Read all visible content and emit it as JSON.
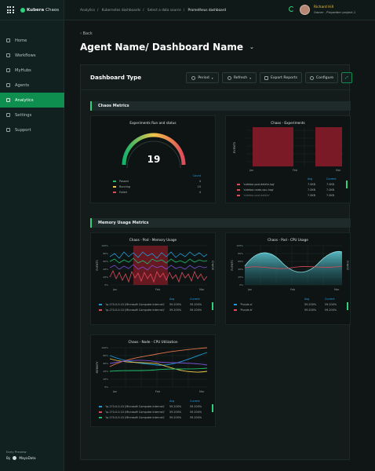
{
  "brand": {
    "name_bold": "Kubera",
    "name_light": "Chaos"
  },
  "sidebar": {
    "items": [
      {
        "label": "Home",
        "icon": "home-icon"
      },
      {
        "label": "Workflows",
        "icon": "workflows-icon"
      },
      {
        "label": "MyHubs",
        "icon": "hub-icon"
      },
      {
        "label": "Agents",
        "icon": "agents-icon"
      },
      {
        "label": "Analytics",
        "icon": "analytics-icon",
        "active": true
      },
      {
        "label": "Settings",
        "icon": "gear-icon"
      },
      {
        "label": "Support",
        "icon": "support-icon"
      }
    ],
    "footer_label": "Early Preview",
    "footer_by": "By",
    "footer_company": "MayaData"
  },
  "topbar": {
    "breadcrumbs": [
      "Analytics",
      "Kubernetes dashboards",
      "Select a data source",
      "Prometheus dashboard"
    ],
    "user_name": "Richard Hill",
    "user_role": "Owner - Playadder project-1"
  },
  "main": {
    "back_label": "Back",
    "title": "Agent Name/ Dashboard Name",
    "dashboard_type": "Dashboard Type",
    "buttons": {
      "period": "Period",
      "refresh": "Refresh",
      "export": "Export Reports",
      "configure": "Configure"
    }
  },
  "sections": {
    "chaos": "Chaos Metrics",
    "memory": "Memory Usage Metrics"
  },
  "cards": {
    "gauge": {
      "title": "Experiments Run and status",
      "value": "19",
      "legend_head": "Count",
      "legend": [
        {
          "label": "Passed",
          "value": "4",
          "color": "#1dbb6a"
        },
        {
          "label": "Running",
          "value": "10",
          "color": "#f0c64a"
        },
        {
          "label": "Failed",
          "value": "4",
          "color": "#e04a5a"
        }
      ]
    },
    "experiments": {
      "title": "Chaos - Experiments",
      "ylabel": "EVENTS",
      "xticks": [
        "Jan",
        "Feb",
        "Mar"
      ],
      "legend_heads": [
        "Avg",
        "Current"
      ],
      "legend": [
        {
          "label": "'sidebar-pod-delete-log'",
          "avg": "7.0KB",
          "cur": "7.0KB"
        },
        {
          "label": "'sidebar-node-cpu-hog'",
          "avg": "7.0KB",
          "cur": "7.0KB"
        },
        {
          "label": "'sidebar-pod-delete'",
          "avg": "7.0KB",
          "cur": "7.0KB"
        }
      ]
    },
    "memory": {
      "title": "Chaos - Pod - Memory Usage",
      "ylabel": "EVENTS",
      "ylabel2": "CHAOS",
      "yticks": [
        "100%",
        "80%",
        "60%",
        "40%",
        "20%",
        "0%"
      ],
      "xticks": [
        "Jan",
        "Feb",
        "Mar"
      ],
      "legend_heads": [
        "Avg",
        "Current"
      ],
      "legend": [
        {
          "label": "'lp-170-0-0-10 (Microsoft Computer.Internal)'",
          "avg": "59.200%",
          "cur": "59.200%",
          "color": "#1d9bd7"
        },
        {
          "label": "'lp-170-0-0-10 (Microsoft Computer.Internal)'",
          "avg": "59.200%",
          "cur": "59.200%",
          "color": "#e04a5a"
        }
      ]
    },
    "cpu": {
      "title": "Chaos - Pod - CPU Usage",
      "ylabel": "EVENTS",
      "ylabel2": "CHAOS",
      "yticks": [
        "100%",
        "80%",
        "60%",
        "40%",
        "20%",
        "0%"
      ],
      "xticks": [
        "Jan",
        "Feb",
        "Mar"
      ],
      "legend_heads": [
        "Avg",
        "Current"
      ],
      "legend": [
        {
          "label": "'Purple-a'",
          "avg": "59.200%",
          "cur": "59.200%",
          "color": "#1d9bd7"
        },
        {
          "label": "'Purple-b'",
          "avg": "59.200%",
          "cur": "59.200%",
          "color": "#e04a5a"
        }
      ]
    },
    "node": {
      "title": "Chaos - Node - CPU Utilization",
      "ylabel": "MEMORY",
      "yticks": [
        "100%",
        "80%",
        "60%",
        "40%",
        "20%",
        "0%"
      ],
      "xticks": [
        "Jan",
        "Feb",
        "Mar"
      ],
      "legend_heads": [
        "Avg",
        "Current"
      ],
      "legend": [
        {
          "label": "'lp-170-0-0-10 (Microsoft Computer.Internal)'",
          "avg": "59.200%",
          "cur": "59.200%",
          "color": "#1d9bd7"
        },
        {
          "label": "'lp-170-0-0-10 (Microsoft Computer.Internal)'",
          "avg": "59.200%",
          "cur": "59.200%",
          "color": "#e04a5a"
        },
        {
          "label": "'lp-170-0-0-10 (Microsoft Computer.Internal)'",
          "avg": "59.200%",
          "cur": "59.200%",
          "color": "#1dbb6a"
        }
      ]
    }
  },
  "colors": {
    "accent": "#0f8f4f",
    "accent_bright": "#2dd27b",
    "danger": "#a5222f",
    "info": "#2f9de0",
    "warning": "#f0c64a"
  }
}
